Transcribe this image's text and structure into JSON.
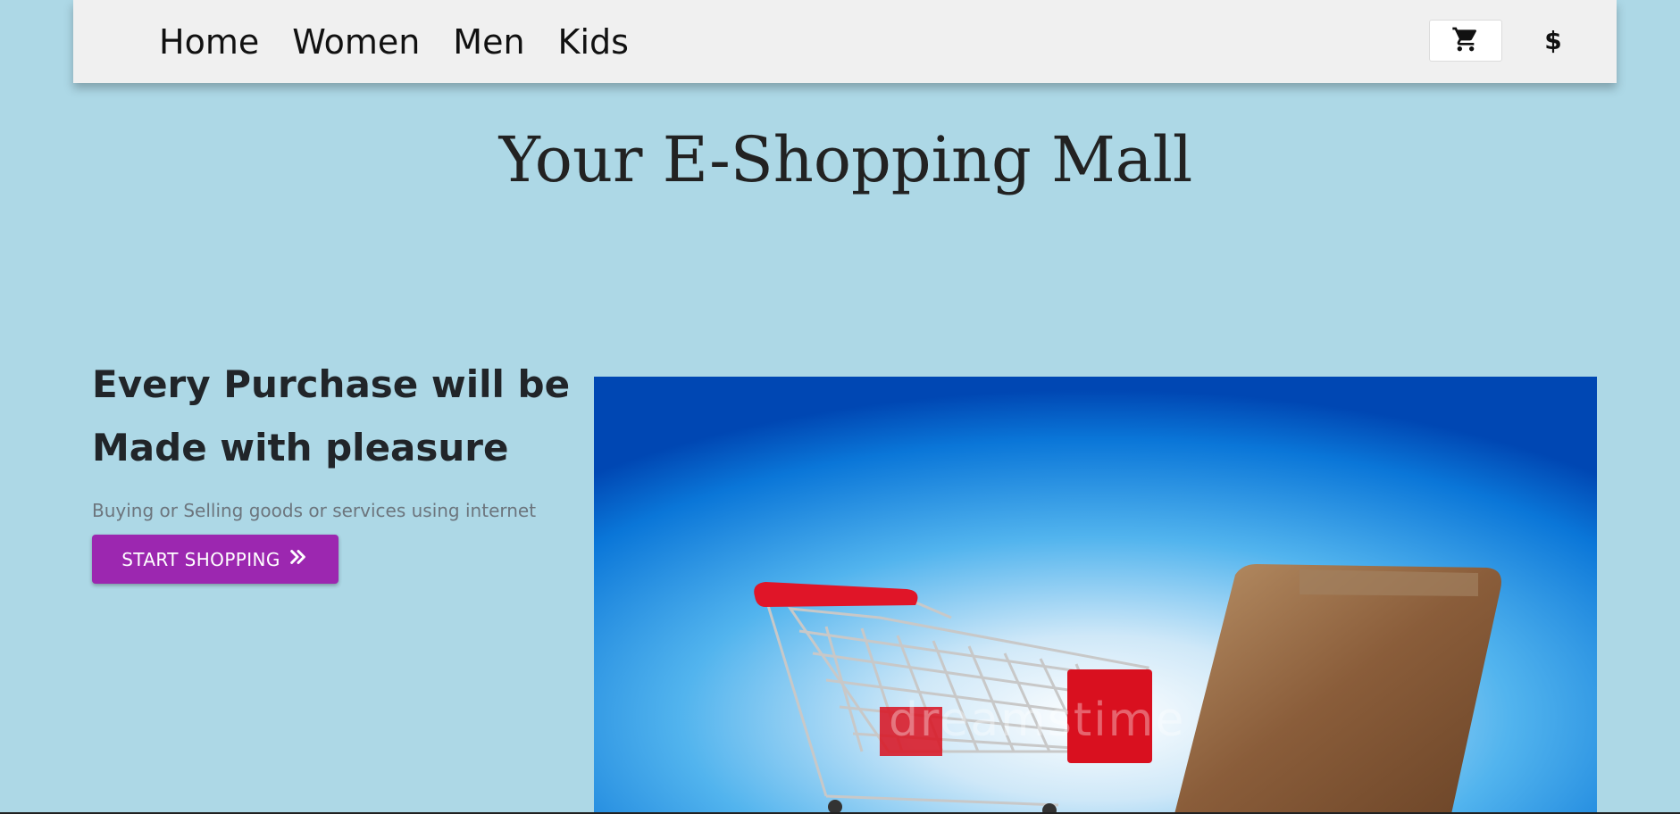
{
  "nav": {
    "links": [
      {
        "label": "Home"
      },
      {
        "label": "Women"
      },
      {
        "label": "Men"
      },
      {
        "label": "Kids"
      }
    ],
    "cart_icon": "shopping-cart-icon",
    "currency_symbol": "$"
  },
  "header": {
    "title": "Your E-Shopping Mall"
  },
  "hero": {
    "heading": "Every Purchase will be Made with pleasure",
    "subtext": "Buying or Selling goods or services using internet",
    "button_label": "START SHOPPING",
    "button_icon": "double-chevron-right-icon",
    "image_description_icon": "shopping-cart-laptop-image",
    "watermark_text": "dreamstime"
  },
  "colors": {
    "page_background": "#add8e6",
    "navbar_background": "#f0f0f0",
    "button_accent": "#9c27b0"
  }
}
